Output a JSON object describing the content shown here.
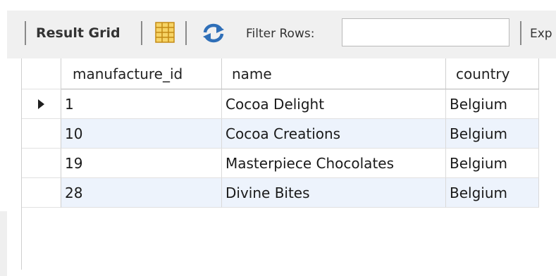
{
  "toolbar": {
    "result_grid_label": "Result Grid",
    "filter_label": "Filter Rows:",
    "filter_value": "",
    "export_label": "Exp",
    "icons": [
      "form-editor-icon",
      "refresh-icon"
    ]
  },
  "grid": {
    "columns": [
      "manufacture_id",
      "name",
      "country"
    ],
    "rows": [
      [
        "1",
        "Cocoa Delight",
        "Belgium"
      ],
      [
        "10",
        "Cocoa Creations",
        "Belgium"
      ],
      [
        "19",
        "Masterpiece Chocolates",
        "Belgium"
      ],
      [
        "28",
        "Divine Bites",
        "Belgium"
      ]
    ],
    "selected_row": 0,
    "alt_row_color": "#edf3fc"
  }
}
